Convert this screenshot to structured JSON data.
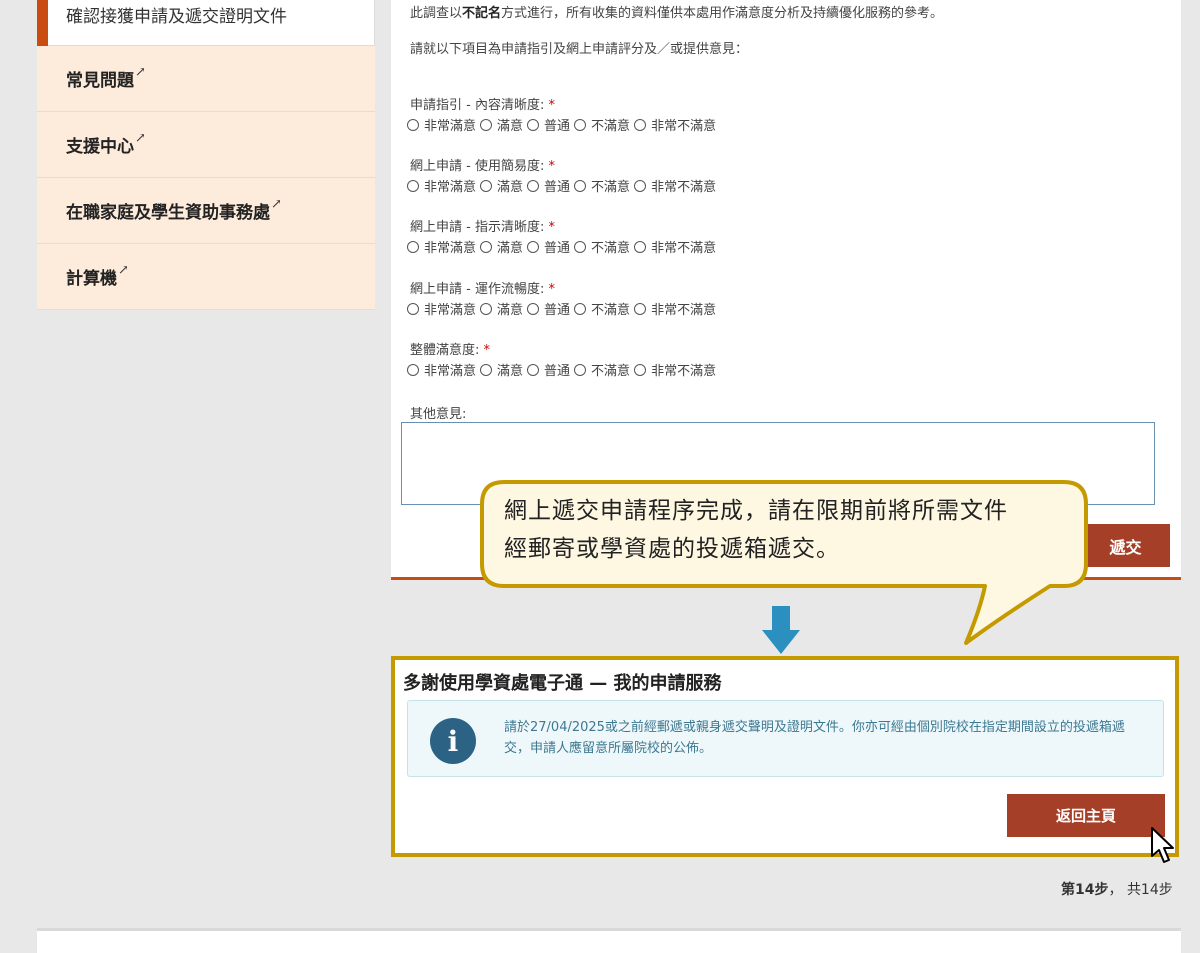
{
  "sidebar": {
    "active_item": "確認接獲申請及遞交證明文件",
    "items": [
      {
        "label": "常見問題"
      },
      {
        "label": "支援中心"
      },
      {
        "label": "在職家庭及學生資助事務處"
      },
      {
        "label": "計算機"
      }
    ],
    "external_icon": "↗"
  },
  "survey": {
    "intro_prefix": "此調查以",
    "intro_bold": "不記名",
    "intro_suffix": "方式進行，所有收集的資料僅供本處用作滿意度分析及持續優化服務的參考。",
    "instruction": "請就以下項目為申請指引及網上申請評分及／或提供意見：",
    "questions": [
      {
        "label": "申請指引 - 內容清晰度:"
      },
      {
        "label": "網上申請 - 使用簡易度:"
      },
      {
        "label": "網上申請 - 指示清晰度:"
      },
      {
        "label": "網上申請 - 運作流暢度:"
      },
      {
        "label": "整體滿意度:"
      }
    ],
    "required_mark": "*",
    "options": [
      "非常滿意",
      "滿意",
      "普通",
      "不滿意",
      "非常不滿意"
    ],
    "other_label": "其他意見:",
    "other_value": "",
    "submit_label": "遞交"
  },
  "callout": {
    "line1": "網上遞交申請程序完成，請在限期前將所需文件",
    "line2": "經郵寄或學資處的投遞箱遞交。"
  },
  "completion": {
    "title": "多謝使用學資處電子通 — 我的申請服務",
    "info_icon": "i",
    "info_text": "請於27/04/2025或之前經郵遞或親身遞交聲明及證明文件。你亦可經由個別院校在指定期間設立的投遞箱遞交，申請人應留意所屬院校的公佈。",
    "home_button": "返回主頁"
  },
  "step_indicator": {
    "current": "第14步",
    "separator": "，",
    "total": "共14步"
  },
  "colors": {
    "accent": "#c94d13",
    "button": "#a63f28",
    "highlight_border": "#c49a00",
    "sidebar_bg": "#fdebdc",
    "info_icon_bg": "#2c6384",
    "arrow": "#2b8fc0"
  }
}
